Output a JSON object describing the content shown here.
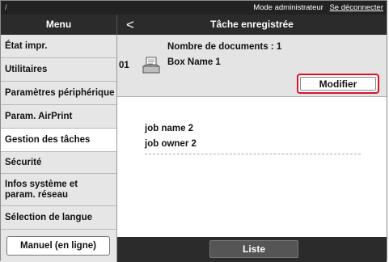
{
  "topbar": {
    "slash": "/",
    "mode_label": "Mode administrateur",
    "logout_link": "Se déconnecter"
  },
  "header": {
    "menu_title": "Menu",
    "back_glyph": "<",
    "page_title": "Tâche enregistrée"
  },
  "sidebar": {
    "items": [
      {
        "label": "État impr."
      },
      {
        "label": "Utilitaires"
      },
      {
        "label": "Paramètres périphérique"
      },
      {
        "label": "Param. AirPrint"
      },
      {
        "label": "Gestion des tâches"
      },
      {
        "label": "Sécurité"
      },
      {
        "label": "Infos système et param. réseau"
      },
      {
        "label": "Sélection de langue"
      }
    ],
    "active_index": 4,
    "manual_button": "Manuel (en ligne)"
  },
  "job": {
    "number": "01",
    "icon": "document-tray-icon",
    "doc_count": "Nombre de documents : 1",
    "box_name": "Box Name 1",
    "modify_button": "Modifier",
    "highlight_color": "#d8102a"
  },
  "job_detail": {
    "name": "job name 2",
    "owner": "job owner 2"
  },
  "bottombar": {
    "list_button": "Liste"
  }
}
